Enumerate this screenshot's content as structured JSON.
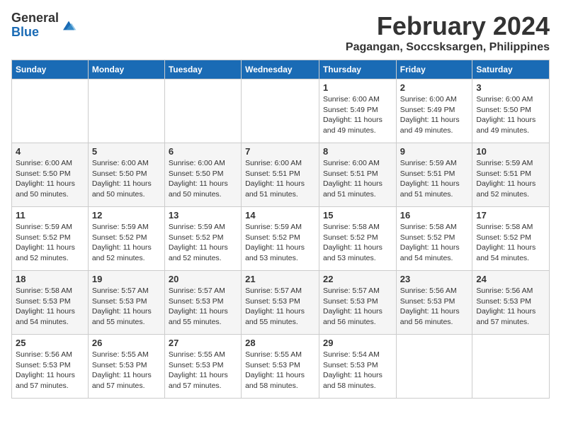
{
  "logo": {
    "general": "General",
    "blue": "Blue"
  },
  "title": "February 2024",
  "subtitle": "Pagangan, Soccsksargen, Philippines",
  "headers": [
    "Sunday",
    "Monday",
    "Tuesday",
    "Wednesday",
    "Thursday",
    "Friday",
    "Saturday"
  ],
  "weeks": [
    [
      {
        "day": "",
        "info": ""
      },
      {
        "day": "",
        "info": ""
      },
      {
        "day": "",
        "info": ""
      },
      {
        "day": "",
        "info": ""
      },
      {
        "day": "1",
        "info": "Sunrise: 6:00 AM\nSunset: 5:49 PM\nDaylight: 11 hours and 49 minutes."
      },
      {
        "day": "2",
        "info": "Sunrise: 6:00 AM\nSunset: 5:49 PM\nDaylight: 11 hours and 49 minutes."
      },
      {
        "day": "3",
        "info": "Sunrise: 6:00 AM\nSunset: 5:50 PM\nDaylight: 11 hours and 49 minutes."
      }
    ],
    [
      {
        "day": "4",
        "info": "Sunrise: 6:00 AM\nSunset: 5:50 PM\nDaylight: 11 hours and 50 minutes."
      },
      {
        "day": "5",
        "info": "Sunrise: 6:00 AM\nSunset: 5:50 PM\nDaylight: 11 hours and 50 minutes."
      },
      {
        "day": "6",
        "info": "Sunrise: 6:00 AM\nSunset: 5:50 PM\nDaylight: 11 hours and 50 minutes."
      },
      {
        "day": "7",
        "info": "Sunrise: 6:00 AM\nSunset: 5:51 PM\nDaylight: 11 hours and 51 minutes."
      },
      {
        "day": "8",
        "info": "Sunrise: 6:00 AM\nSunset: 5:51 PM\nDaylight: 11 hours and 51 minutes."
      },
      {
        "day": "9",
        "info": "Sunrise: 5:59 AM\nSunset: 5:51 PM\nDaylight: 11 hours and 51 minutes."
      },
      {
        "day": "10",
        "info": "Sunrise: 5:59 AM\nSunset: 5:51 PM\nDaylight: 11 hours and 52 minutes."
      }
    ],
    [
      {
        "day": "11",
        "info": "Sunrise: 5:59 AM\nSunset: 5:52 PM\nDaylight: 11 hours and 52 minutes."
      },
      {
        "day": "12",
        "info": "Sunrise: 5:59 AM\nSunset: 5:52 PM\nDaylight: 11 hours and 52 minutes."
      },
      {
        "day": "13",
        "info": "Sunrise: 5:59 AM\nSunset: 5:52 PM\nDaylight: 11 hours and 52 minutes."
      },
      {
        "day": "14",
        "info": "Sunrise: 5:59 AM\nSunset: 5:52 PM\nDaylight: 11 hours and 53 minutes."
      },
      {
        "day": "15",
        "info": "Sunrise: 5:58 AM\nSunset: 5:52 PM\nDaylight: 11 hours and 53 minutes."
      },
      {
        "day": "16",
        "info": "Sunrise: 5:58 AM\nSunset: 5:52 PM\nDaylight: 11 hours and 54 minutes."
      },
      {
        "day": "17",
        "info": "Sunrise: 5:58 AM\nSunset: 5:52 PM\nDaylight: 11 hours and 54 minutes."
      }
    ],
    [
      {
        "day": "18",
        "info": "Sunrise: 5:58 AM\nSunset: 5:53 PM\nDaylight: 11 hours and 54 minutes."
      },
      {
        "day": "19",
        "info": "Sunrise: 5:57 AM\nSunset: 5:53 PM\nDaylight: 11 hours and 55 minutes."
      },
      {
        "day": "20",
        "info": "Sunrise: 5:57 AM\nSunset: 5:53 PM\nDaylight: 11 hours and 55 minutes."
      },
      {
        "day": "21",
        "info": "Sunrise: 5:57 AM\nSunset: 5:53 PM\nDaylight: 11 hours and 55 minutes."
      },
      {
        "day": "22",
        "info": "Sunrise: 5:57 AM\nSunset: 5:53 PM\nDaylight: 11 hours and 56 minutes."
      },
      {
        "day": "23",
        "info": "Sunrise: 5:56 AM\nSunset: 5:53 PM\nDaylight: 11 hours and 56 minutes."
      },
      {
        "day": "24",
        "info": "Sunrise: 5:56 AM\nSunset: 5:53 PM\nDaylight: 11 hours and 57 minutes."
      }
    ],
    [
      {
        "day": "25",
        "info": "Sunrise: 5:56 AM\nSunset: 5:53 PM\nDaylight: 11 hours and 57 minutes."
      },
      {
        "day": "26",
        "info": "Sunrise: 5:55 AM\nSunset: 5:53 PM\nDaylight: 11 hours and 57 minutes."
      },
      {
        "day": "27",
        "info": "Sunrise: 5:55 AM\nSunset: 5:53 PM\nDaylight: 11 hours and 57 minutes."
      },
      {
        "day": "28",
        "info": "Sunrise: 5:55 AM\nSunset: 5:53 PM\nDaylight: 11 hours and 58 minutes."
      },
      {
        "day": "29",
        "info": "Sunrise: 5:54 AM\nSunset: 5:53 PM\nDaylight: 11 hours and 58 minutes."
      },
      {
        "day": "",
        "info": ""
      },
      {
        "day": "",
        "info": ""
      }
    ]
  ]
}
